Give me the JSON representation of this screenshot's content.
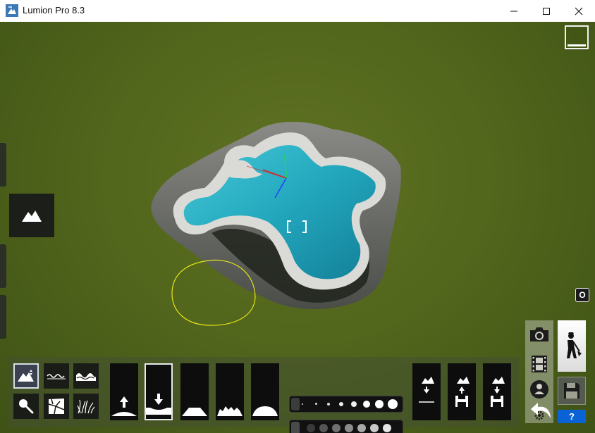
{
  "window": {
    "title": "Lumion Pro 8.3",
    "minimize_icon": "minimize-icon",
    "maximize_icon": "maximize-icon",
    "close_icon": "close-icon"
  },
  "viewport": {
    "o_key_label": "O",
    "crosshair_icon": "focus-crosshair-icon"
  },
  "left_panel": {
    "mode_icon": "landscape-mountain-icon"
  },
  "toolbar": {
    "small_tools": [
      {
        "id": "height",
        "icon": "mountain-height-icon",
        "active": true
      },
      {
        "id": "water",
        "icon": "water-waves-icon",
        "active": false
      },
      {
        "id": "ocean",
        "icon": "ocean-waves-icon",
        "active": false
      },
      {
        "id": "paint",
        "icon": "paint-brush-icon",
        "active": false
      },
      {
        "id": "openstreetmap",
        "icon": "map-icon",
        "active": false
      },
      {
        "id": "grass",
        "icon": "grass-icon",
        "active": false
      }
    ],
    "brushes": [
      {
        "id": "raise",
        "icon": "raise-terrain-icon",
        "active": false
      },
      {
        "id": "lower",
        "icon": "lower-terrain-icon",
        "active": true
      },
      {
        "id": "flatten",
        "icon": "flatten-terrain-icon",
        "active": false
      },
      {
        "id": "roughen",
        "icon": "roughen-terrain-icon",
        "active": false
      },
      {
        "id": "smooth",
        "icon": "smooth-terrain-icon",
        "active": false
      }
    ],
    "brush_size_level": 0.08,
    "brush_speed_level": 0.08,
    "terrain_actions": [
      {
        "id": "flatten-all",
        "icon": "flatten-all-icon"
      },
      {
        "id": "load-terrain",
        "icon": "load-terrain-icon"
      },
      {
        "id": "save-terrain",
        "icon": "save-terrain-icon"
      }
    ]
  },
  "right_panel": {
    "photo_icon": "camera-icon",
    "movie_icon": "film-strip-icon",
    "panorama_icon": "person-360-icon",
    "settings_icon": "gear-icon",
    "build_icon": "build-worker-icon",
    "save_icon": "save-floppy-icon",
    "undo_icon": "undo-arrow-icon",
    "help_label": "?"
  },
  "colors": {
    "grass": "#52661c",
    "water": "#2fb8cc",
    "help_blue": "#0a63d6"
  }
}
